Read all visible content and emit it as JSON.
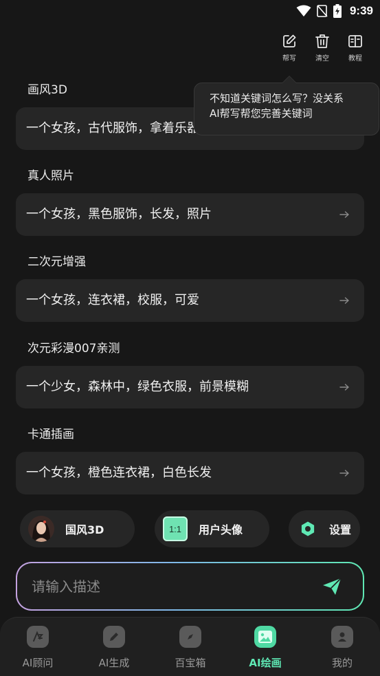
{
  "status_bar": {
    "time": "9:39"
  },
  "toolbar": [
    {
      "label": "帮写",
      "icon": "edit-icon"
    },
    {
      "label": "清空",
      "icon": "trash-icon"
    },
    {
      "label": "教程",
      "icon": "book-icon"
    }
  ],
  "tooltip": {
    "line1": "不知道关键词怎么写？没关系",
    "line2": "AI帮写帮您完善关键词"
  },
  "prompt_sections": [
    {
      "title": "画风3D",
      "text": "一个女孩，古代服饰，拿着乐器"
    },
    {
      "title": "真人照片",
      "text": "一个女孩，黑色服饰，长发，照片"
    },
    {
      "title": "二次元增强",
      "text": "一个女孩，连衣裙，校服，可爱"
    },
    {
      "title": "次元彩漫007亲测",
      "text": "一个少女，森林中，绿色衣服，前景模糊"
    },
    {
      "title": "卡通插画",
      "text": "一个女孩，橙色连衣裙，白色长发"
    }
  ],
  "options": {
    "style_label": "国风3D",
    "ratio_value": "1:1",
    "ratio_label": "用户头像",
    "settings_label": "设置"
  },
  "input": {
    "placeholder": "请输入描述"
  },
  "bottom_nav": [
    {
      "label": "AI顾问",
      "icon": "ai-advisor-icon",
      "active": false
    },
    {
      "label": "AI生成",
      "icon": "pen-icon",
      "active": false
    },
    {
      "label": "百宝箱",
      "icon": "compass-icon",
      "active": false
    },
    {
      "label": "AI绘画",
      "icon": "picture-icon",
      "active": true
    },
    {
      "label": "我的",
      "icon": "user-icon",
      "active": false
    }
  ],
  "colors": {
    "background": "#171717",
    "card": "#262626",
    "accent": "#5fe8b4"
  }
}
